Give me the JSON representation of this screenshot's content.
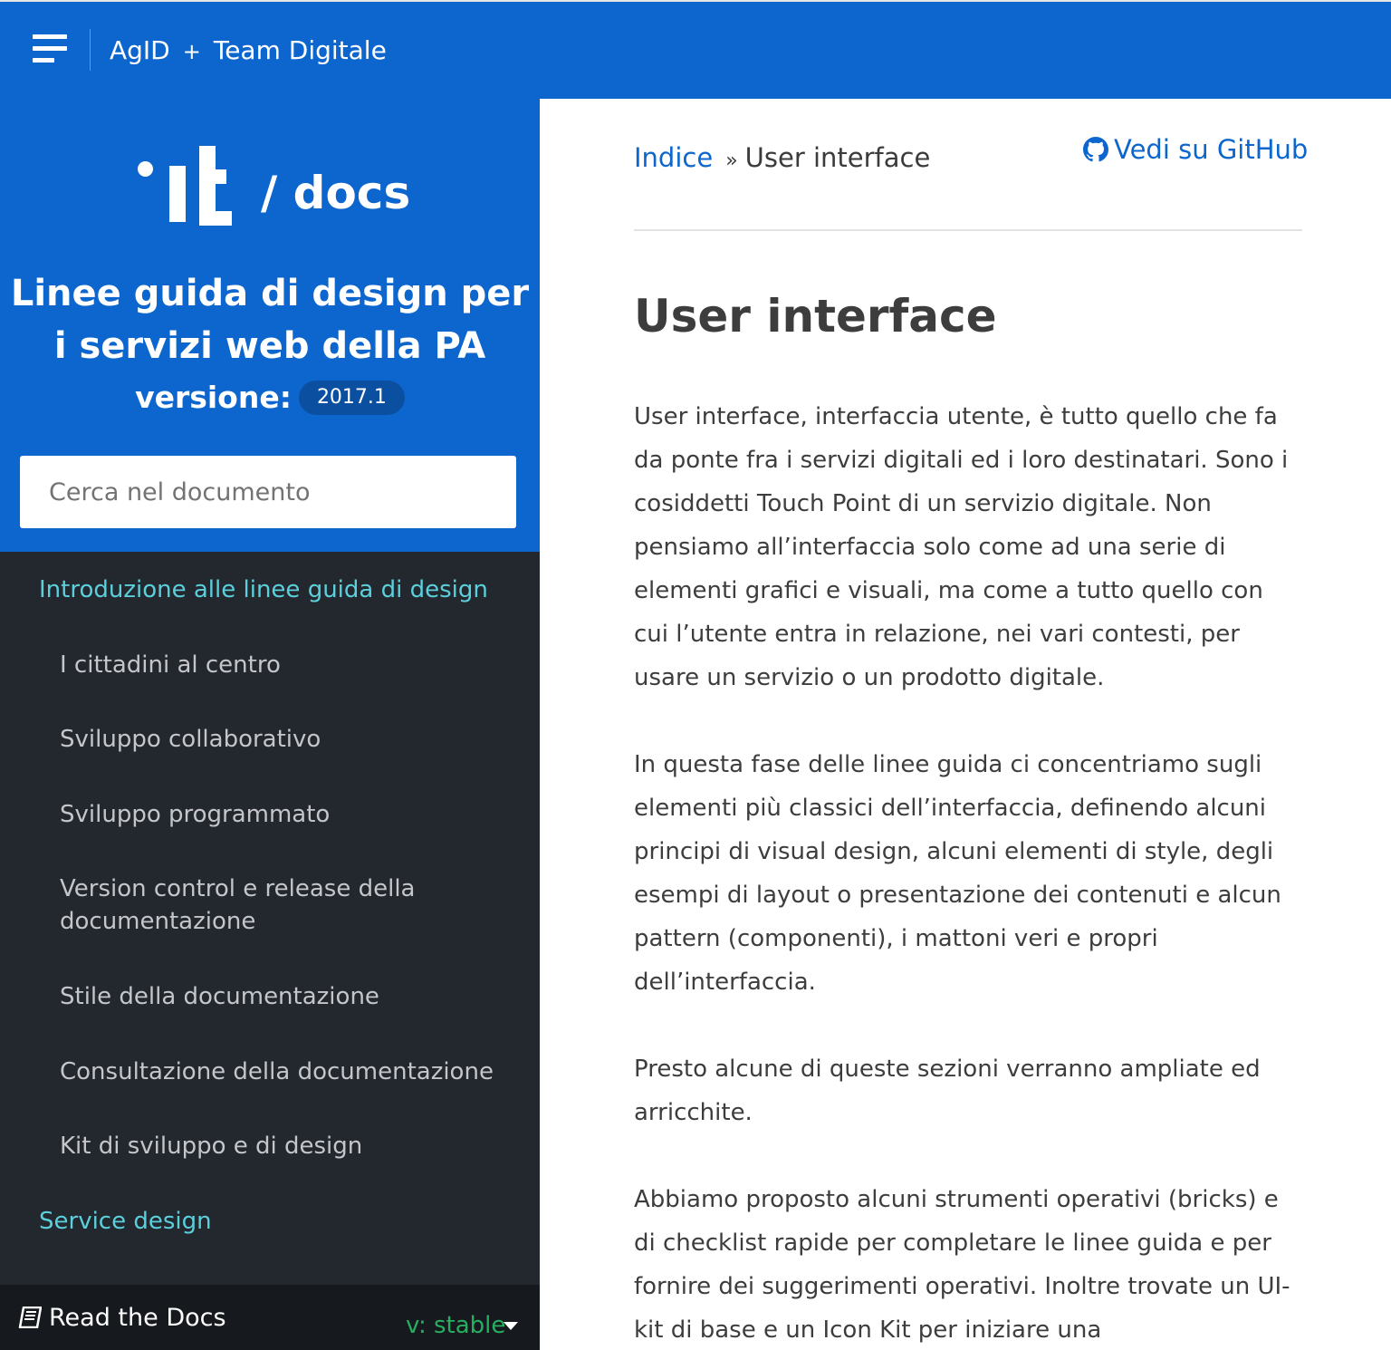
{
  "topbar": {
    "brand_left": "AgID",
    "brand_plus": "+",
    "brand_right": "Team Digitale"
  },
  "sidebar": {
    "logo_text": "/ docs",
    "project_title": "Linee guida di design per i servizi web della PA",
    "version_label": "versione:",
    "version_value": "2017.1",
    "search_placeholder": "Cerca nel documento",
    "nav": [
      {
        "label": "Introduzione alle linee guida di design",
        "type": "caption"
      },
      {
        "label": "I cittadini al centro",
        "type": "item"
      },
      {
        "label": "Sviluppo collaborativo",
        "type": "item"
      },
      {
        "label": "Sviluppo programmato",
        "type": "item"
      },
      {
        "label": "Version control e release della documentazione",
        "type": "item"
      },
      {
        "label": "Stile della documentazione",
        "type": "item"
      },
      {
        "label": "Consultazione della documentazione",
        "type": "item"
      },
      {
        "label": "Kit di sviluppo e di design",
        "type": "item"
      },
      {
        "label": "Service design",
        "type": "caption"
      }
    ],
    "rtd_label": "Read the Docs",
    "rtd_version": "v: stable"
  },
  "content": {
    "breadcrumb_root": "Indice",
    "breadcrumb_sep": "»",
    "breadcrumb_current": "User interface",
    "github_label": "Vedi su GitHub",
    "heading": "User interface",
    "paragraphs": [
      "User interface, interfaccia utente, è tutto quello che fa da ponte fra i servizi digitali ed i loro destinatari. Sono i cosiddetti Touch Point di un servizio digitale. Non pensiamo all’interfaccia solo come ad una serie di elementi grafici e visuali, ma come a tutto quello con cui l’utente entra in relazione, nei vari contesti, per usare un servizio o un prodotto digitale.",
      "In questa fase delle linee guida ci concentriamo sugli elementi più classici dell’interfaccia, definendo alcuni principi di visual design, alcuni elementi di style, degli esempi di layout o presentazione dei contenuti e alcun pattern (componenti), i mattoni veri e propri dell’interfaccia.",
      "Presto alcune di queste sezioni verranno ampliate ed arricchite.",
      "Abbiamo proposto alcuni strumenti operativi (bricks) e di checklist rapide per completare le linee guida e per fornire dei suggerimenti operativi. Inoltre trovate un UI-kit di base e un Icon Kit per iniziare una"
    ]
  },
  "colors": {
    "brand_blue": "#0c66cd",
    "sidebar_dark": "#23272e",
    "caption_cyan": "#5bd0dc",
    "version_green": "#27ae60"
  },
  "icons": [
    "hamburger-menu-icon",
    "italia-logo-icon",
    "github-icon",
    "book-icon",
    "caret-down-icon"
  ]
}
